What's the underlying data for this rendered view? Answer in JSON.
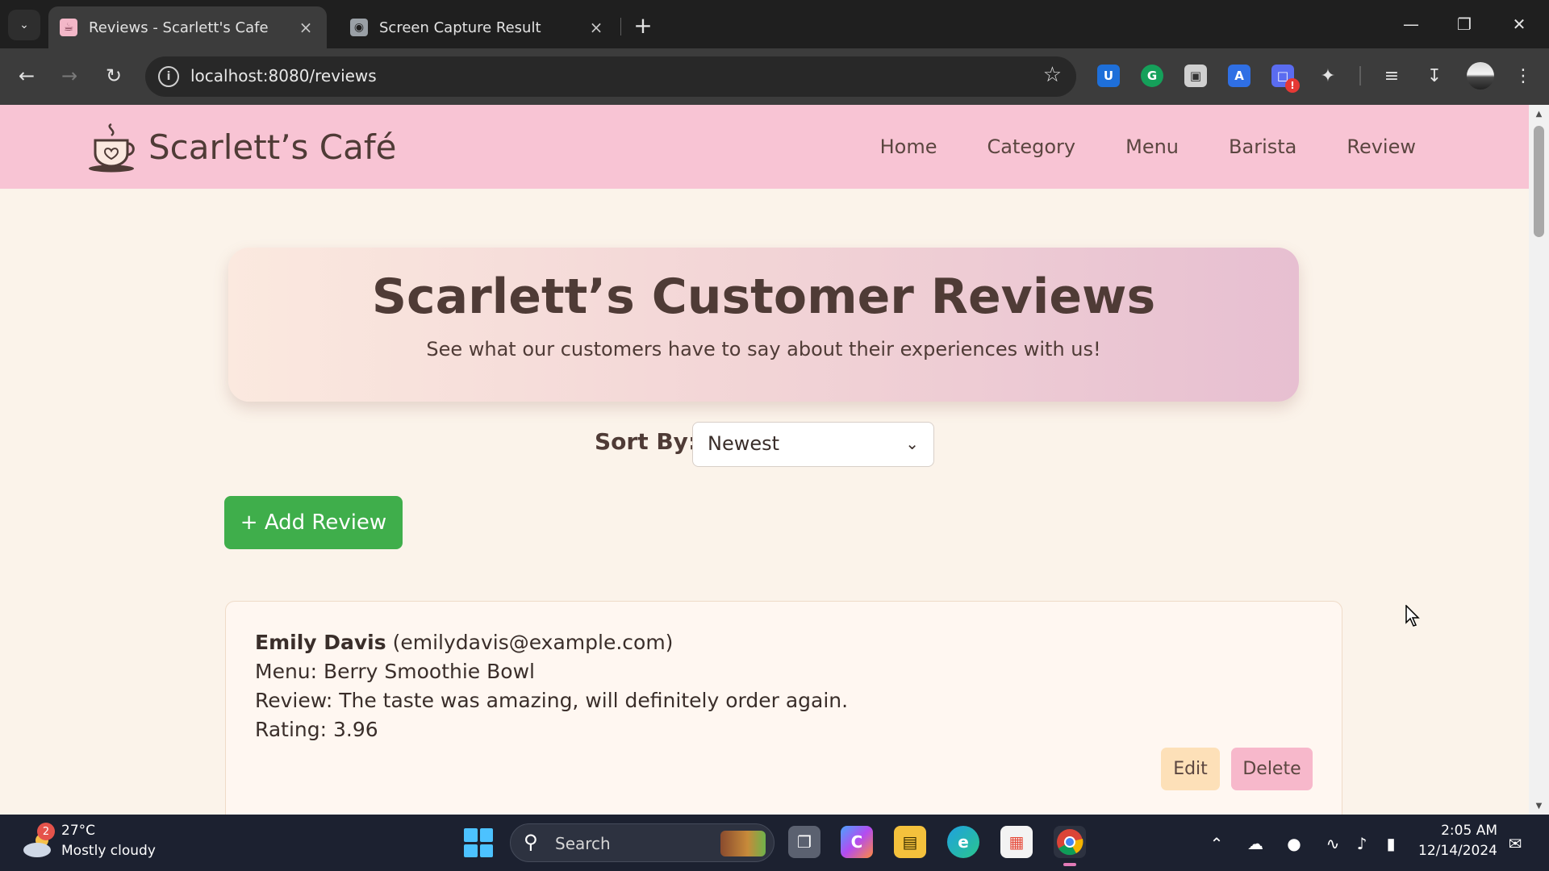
{
  "browser": {
    "tabs": [
      {
        "title": "Reviews - Scarlett's Cafe",
        "active": true
      },
      {
        "title": "Screen Capture Result",
        "active": false
      }
    ],
    "url": "localhost:8080/reviews"
  },
  "site": {
    "brand": "Scarlett’s Café",
    "nav": [
      "Home",
      "Category",
      "Menu",
      "Barista",
      "Review"
    ]
  },
  "hero": {
    "title": "Scarlett’s Customer Reviews",
    "subtitle": "See what our customers have to say about their experiences with us!"
  },
  "sort": {
    "label": "Sort By:",
    "selected": "Newest"
  },
  "add_button_label": "+ Add Review",
  "reviews": [
    {
      "name": "Emily Davis",
      "email": "(emilydavis@example.com)",
      "menu": "Menu: Berry Smoothie Bowl",
      "review": "Review: The taste was amazing, will definitely order again.",
      "rating": "Rating: 3.96",
      "edit_label": "Edit",
      "delete_label": "Delete"
    }
  ],
  "taskbar": {
    "weather_badge": "2",
    "temperature": "27°C",
    "condition": "Mostly cloudy",
    "search_placeholder": "Search",
    "time": "2:05 AM",
    "date": "12/14/2024"
  },
  "colors": {
    "header_bg": "#f8c4d4",
    "page_bg": "#fbf3ea",
    "add_button": "#3fae4b",
    "edit_button": "#fde0b8",
    "delete_button": "#f7b8cb",
    "text": "#4f3b36"
  }
}
